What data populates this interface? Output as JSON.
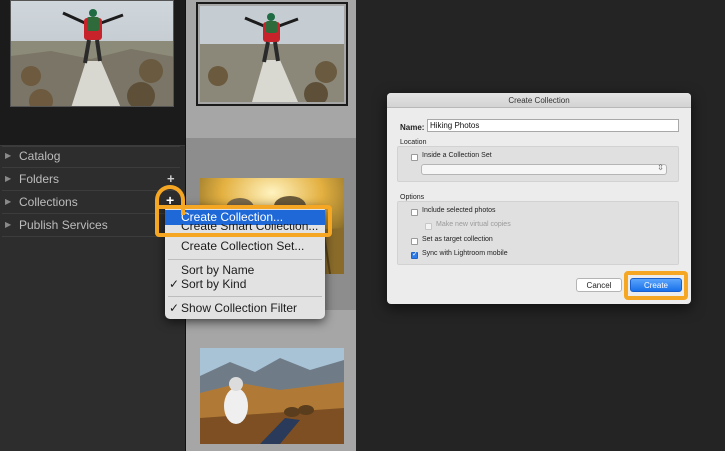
{
  "left_panel": {
    "items": [
      {
        "label": "Catalog"
      },
      {
        "label": "Folders",
        "plus": "+"
      },
      {
        "label": "Collections",
        "plus": "+"
      },
      {
        "label": "Publish Services"
      }
    ]
  },
  "context_menu": {
    "items": [
      {
        "label": "Create Collection...",
        "highlighted": true
      },
      {
        "label": "Create Smart Collection..."
      },
      {
        "label": "Create Collection Set..."
      },
      {
        "label": "Sort by Name"
      },
      {
        "label": "Sort by Kind",
        "checked": true
      },
      {
        "label": "Show Collection Filter",
        "checked": true
      }
    ],
    "check_glyph": "✓"
  },
  "dialog": {
    "title": "Create Collection",
    "name_label": "Name:",
    "name_value": "Hiking Photos",
    "location_header": "Location",
    "inside_set_label": "Inside a Collection Set",
    "options_header": "Options",
    "include_selected_label": "Include selected photos",
    "virtual_copies_label": "Make new virtual copies",
    "set_target_label": "Set as target collection",
    "sync_mobile_label": "Sync with Lightroom mobile",
    "cancel_label": "Cancel",
    "create_label": "Create"
  },
  "colors": {
    "accent_orange": "#f5a623",
    "menu_highlight": "#1e68d8",
    "create_button": "#1a71ea"
  },
  "icons": {
    "disclosure": "triangle-right-icon",
    "plus": "plus-icon",
    "select_arrows": "updown-chevron-icon"
  }
}
